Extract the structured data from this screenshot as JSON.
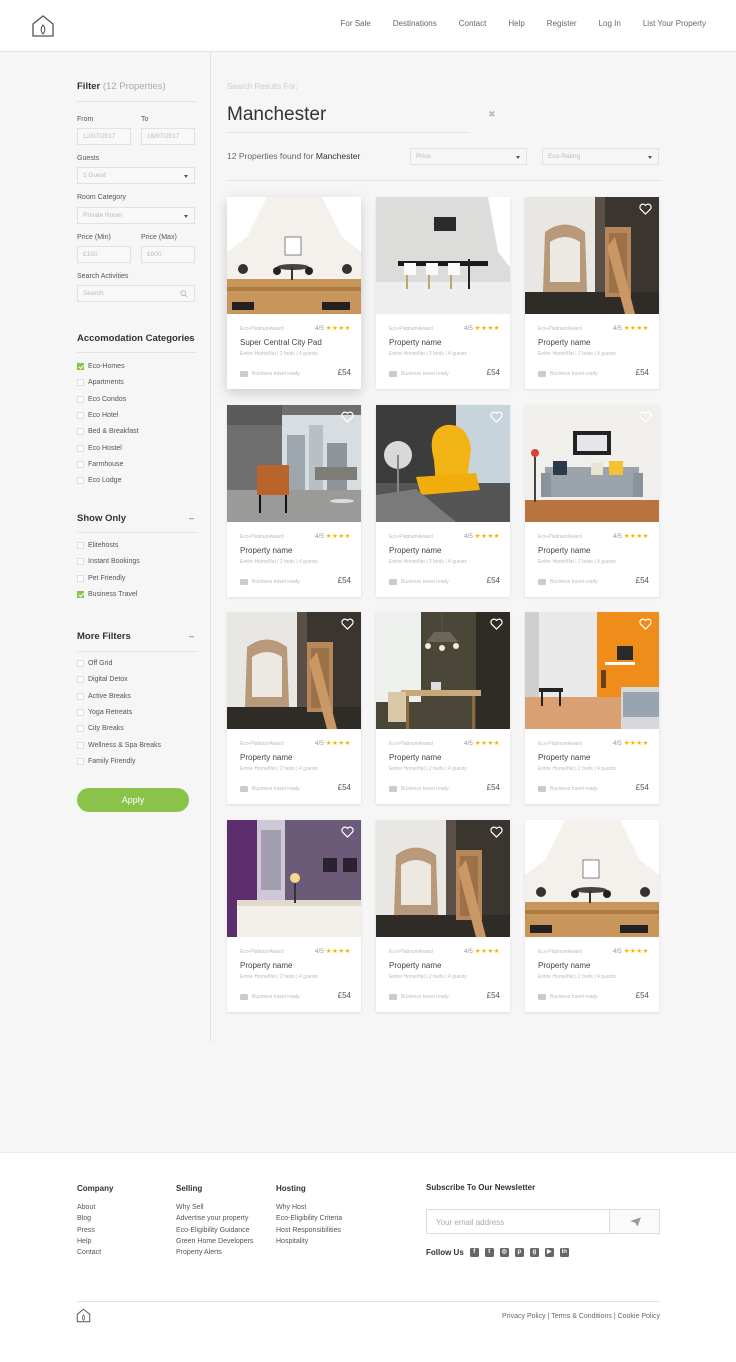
{
  "nav": {
    "links": [
      "For Sale",
      "Destinations",
      "Contact",
      "Help",
      "Register",
      "Log In",
      "List Your Property"
    ]
  },
  "filter": {
    "title": "Filter",
    "count": "(12 Properties)",
    "from_label": "From",
    "from_value": "12/07/2017",
    "to_label": "To",
    "to_value": "16/07/2017",
    "guests_label": "Guests",
    "guests_value": "1 Guest",
    "room_label": "Room Category",
    "room_value": "Private Room",
    "price_min_label": "Price (Min)",
    "price_min_value": "£150",
    "price_max_label": "Price (Max)",
    "price_max_value": "£600",
    "search_label": "Search Activities",
    "search_placeholder": "Search"
  },
  "accommodation": {
    "title": "Accomodation Categories",
    "toggle": "–",
    "items": [
      {
        "label": "Eco-Homes",
        "checked": true
      },
      {
        "label": "Apartments",
        "checked": false
      },
      {
        "label": "Eco Condos",
        "checked": false
      },
      {
        "label": "Eco Hotel",
        "checked": false
      },
      {
        "label": "Bed & Breakfast",
        "checked": false
      },
      {
        "label": "Eco Hostel",
        "checked": false
      },
      {
        "label": "Farmhouse",
        "checked": false
      },
      {
        "label": "Eco Lodge",
        "checked": false
      }
    ]
  },
  "show_only": {
    "title": "Show Only",
    "toggle": "–",
    "items": [
      {
        "label": "Elitehosts",
        "checked": false
      },
      {
        "label": "Instant Bookings",
        "checked": false
      },
      {
        "label": "Pet Friendly",
        "checked": false
      },
      {
        "label": "Business Travel",
        "checked": true
      }
    ]
  },
  "more_filters": {
    "title": "More Filters",
    "toggle": "–",
    "items": [
      {
        "label": "Off Grid",
        "checked": false
      },
      {
        "label": "Digital Detox",
        "checked": false
      },
      {
        "label": "Active Breaks",
        "checked": false
      },
      {
        "label": "Yoga Retreats",
        "checked": false
      },
      {
        "label": "City Breaks",
        "checked": false
      },
      {
        "label": "Wellness & Spa Breaks",
        "checked": false
      },
      {
        "label": "Family Firendly",
        "checked": false
      }
    ]
  },
  "apply_label": "Apply",
  "results": {
    "search_hint": "Search Results For:",
    "city": "Manchester",
    "clear": "✖",
    "found_prefix": "12 Properties found for",
    "found_city": "Manchester",
    "price_select": "Price",
    "eco_select": "Eco-Rating"
  },
  "properties": [
    {
      "name": "Super Central City Pad",
      "award": "Eco-PlatinumAward",
      "rating": "4/5",
      "stars": "★★★★",
      "desc": "Entire Home/flat | 2 beds | 4 guests",
      "tag": "Business travel ready",
      "price": "£54",
      "photo": "attic"
    },
    {
      "name": "Property name",
      "award": "Eco-PlatinumAward",
      "rating": "4/5",
      "stars": "★★★★",
      "desc": "Entire Home/flat | 2 beds | 4 guests",
      "tag": "Business travel ready",
      "price": "£54",
      "photo": "dining"
    },
    {
      "name": "Property name",
      "award": "Eco-PlatinumAward",
      "rating": "4/5",
      "stars": "★★★★",
      "desc": "Entire Home/flat | 2 beds | 4 guests",
      "tag": "Business travel ready",
      "price": "£54",
      "photo": "chair"
    },
    {
      "name": "Property name",
      "award": "Eco-PlatinumAward",
      "rating": "4/5",
      "stars": "★★★★",
      "desc": "Entire Home/flat | 2 beds | 4 guests",
      "tag": "Business travel ready",
      "price": "£54",
      "photo": "window"
    },
    {
      "name": "Property name",
      "award": "Eco-PlatinumAward",
      "rating": "4/5",
      "stars": "★★★★",
      "desc": "Entire Home/flat | 2 beds | 4 guests",
      "tag": "Business travel ready",
      "price": "£54",
      "photo": "yellow"
    },
    {
      "name": "Property name",
      "award": "Eco-PlatinumAward",
      "rating": "4/5",
      "stars": "★★★★",
      "desc": "Entire Home/flat | 2 beds | 4 guests",
      "tag": "Business travel ready",
      "price": "£54",
      "photo": "sofa"
    },
    {
      "name": "Property name",
      "award": "Eco-PlatinumAward",
      "rating": "4/5",
      "stars": "★★★★",
      "desc": "Entire Home/flat | 2 beds | 4 guests",
      "tag": "Business travel ready",
      "price": "£54",
      "photo": "chair"
    },
    {
      "name": "Property name",
      "award": "Eco-PlatinumAward",
      "rating": "4/5",
      "stars": "★★★★",
      "desc": "Entire Home/flat | 2 beds | 4 guests",
      "tag": "Business travel ready",
      "price": "£54",
      "photo": "kitchen"
    },
    {
      "name": "Property name",
      "award": "Eco-PlatinumAward",
      "rating": "4/5",
      "stars": "★★★★",
      "desc": "Entire Home/flat | 2 beds | 4 guests",
      "tag": "Business travel ready",
      "price": "£54",
      "photo": "orange"
    },
    {
      "name": "Property name",
      "award": "Eco-PlatinumAward",
      "rating": "4/5",
      "stars": "★★★★",
      "desc": "Entire Home/flat | 2 beds | 4 guests",
      "tag": "Business travel ready",
      "price": "£54",
      "photo": "bedroom"
    },
    {
      "name": "Property name",
      "award": "Eco-PlatinumAward",
      "rating": "4/5",
      "stars": "★★★★",
      "desc": "Entire Home/flat | 2 beds | 4 guests",
      "tag": "Business travel ready",
      "price": "£54",
      "photo": "chair"
    },
    {
      "name": "Property name",
      "award": "Eco-PlatinumAward",
      "rating": "4/5",
      "stars": "★★★★",
      "desc": "Entire Home/flat | 2 beds | 4 guests",
      "tag": "Business travel ready",
      "price": "£54",
      "photo": "attic"
    }
  ],
  "footer": {
    "company": {
      "title": "Company",
      "links": [
        "About",
        "Blog",
        "Press",
        "Help",
        "Contact"
      ]
    },
    "selling": {
      "title": "Selling",
      "links": [
        "Why Sell",
        "Advertise your property",
        "Eco-Eligibility Guidance",
        "Green Home Developers",
        "Property Alerts"
      ]
    },
    "hosting": {
      "title": "Hosting",
      "links": [
        "Why Host",
        "Eco-Eligibility Criteria",
        "Host Responsibilities",
        "Hospitality"
      ]
    },
    "newsletter_title": "Subscribe To Our Newsletter",
    "email_placeholder": "Your email address",
    "follow_label": "Follow Us",
    "socials": [
      "facebook-icon",
      "twitter-icon",
      "instagram-icon",
      "pinterest-icon",
      "google-plus-icon",
      "youtube-icon",
      "linkedin-icon"
    ],
    "legal": "Privacy Policy | Terms & Conditions | Cookie Policy"
  },
  "colors": {
    "accent": "#8bc34a",
    "star": "#f7b500"
  }
}
